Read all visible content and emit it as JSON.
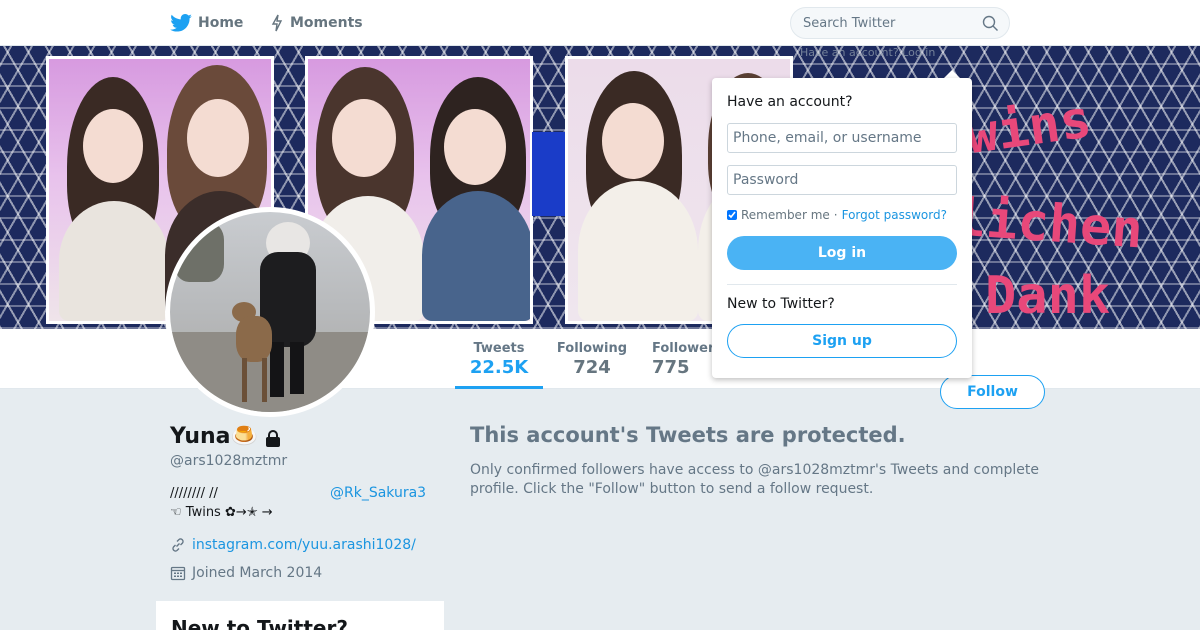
{
  "topbar": {
    "home_label": "Home",
    "moments_label": "Moments",
    "search_placeholder": "Search Twitter"
  },
  "banner": {
    "text_line1": "Twins",
    "text_line2": "lichen",
    "text_line3": "Dank :)"
  },
  "profile": {
    "name": "Yuna🍮",
    "handle": "@ars1028mztmr",
    "bio_line1": "//////// //",
    "bio_mention": "@Rk_Sakura3",
    "bio_line2": "☜ Twins ✿→✭ →",
    "link": "instagram.com/yuu.arashi1028/",
    "joined": "Joined March 2014"
  },
  "stats": {
    "tweets_label": "Tweets",
    "tweets_value": "22.5K",
    "following_label": "Following",
    "following_value": "724",
    "followers_label": "Followers",
    "followers_value": "775"
  },
  "follow_label": "Follow",
  "protected": {
    "title": "This account's Tweets are protected.",
    "body": "Only confirmed followers have access to @ars1028mztmr's Tweets and complete profile. Click the \"Follow\" button to send a follow request."
  },
  "sidebar_card": {
    "title": "New to Twitter?"
  },
  "login": {
    "header_text": "Have an account? Log in",
    "title": "Have an account?",
    "username_placeholder": "Phone, email, or username",
    "password_placeholder": "Password",
    "remember_label": "Remember me",
    "separator": "·",
    "forgot_label": "Forgot password?",
    "login_button": "Log in",
    "new_label": "New to Twitter?",
    "signup_button": "Sign up"
  },
  "colors": {
    "accent": "#1da1f2",
    "background": "#e6ecf0",
    "banner_text": "#e8487a"
  }
}
